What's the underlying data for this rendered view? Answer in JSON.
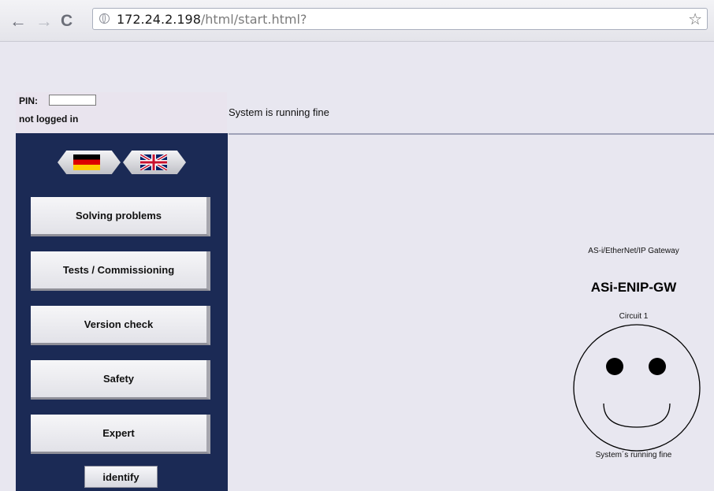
{
  "browser": {
    "url_host": "172.24.2.198",
    "url_path": "/html/start.html?",
    "back_icon": "←",
    "forward_icon": "→",
    "reload_icon": "C",
    "star_icon": "☆"
  },
  "login": {
    "pin_label": "PIN:",
    "pin_value": "",
    "status": "not logged in"
  },
  "status_message": "System is running fine",
  "languages": [
    {
      "name": "german-flag"
    },
    {
      "name": "uk-flag"
    }
  ],
  "menu": {
    "items": [
      {
        "label": "Solving problems"
      },
      {
        "label": "Tests / Commissioning"
      },
      {
        "label": "Version check"
      },
      {
        "label": "Safety"
      },
      {
        "label": "Expert"
      }
    ],
    "identify_label": "identify"
  },
  "gateway": {
    "subtitle": "AS-i/EtherNet/IP Gateway",
    "title": "ASi-ENIP-GW",
    "circuit": "Circuit 1",
    "status_caption": "System´s running fine"
  },
  "colors": {
    "sidebar": "#1b2a55",
    "background": "#e8e7f0"
  }
}
